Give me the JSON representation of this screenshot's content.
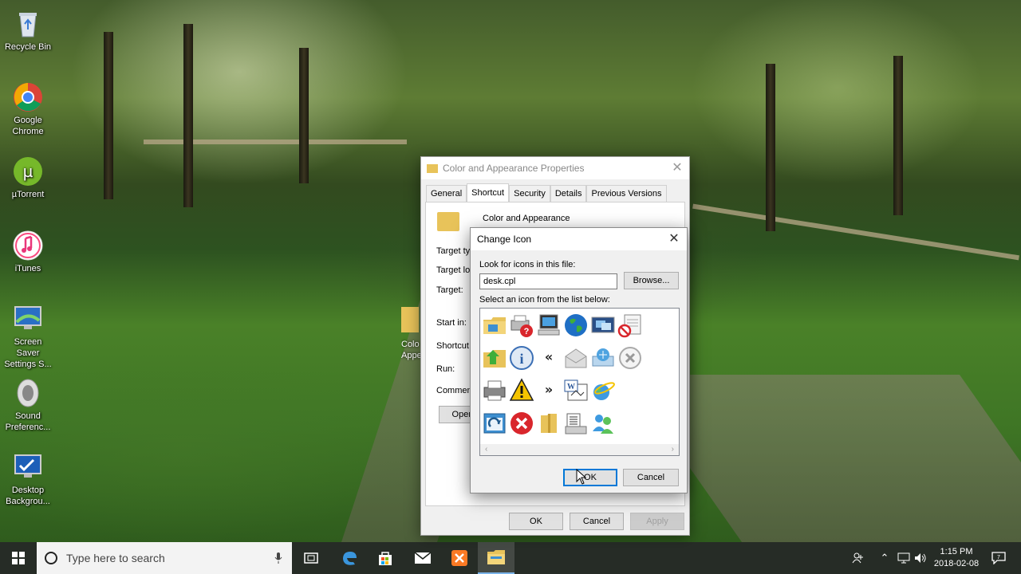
{
  "desktop_icons": [
    {
      "label": "Recycle Bin",
      "icon": "recycle-bin-icon"
    },
    {
      "label": "Google Chrome",
      "icon": "chrome-icon"
    },
    {
      "label": "µTorrent",
      "icon": "utorrent-icon"
    },
    {
      "label": "iTunes",
      "icon": "itunes-icon"
    },
    {
      "label": "Screen Saver Settings S...",
      "icon": "screensaver-icon"
    },
    {
      "label": "Sound Preferenc...",
      "icon": "speaker-icon"
    },
    {
      "label": "Desktop Backgrou...",
      "icon": "desktop-background-icon"
    }
  ],
  "partial_desktop_label": "Colo Appe",
  "properties": {
    "title": "Color and Appearance Properties",
    "tabs": [
      "General",
      "Shortcut",
      "Security",
      "Details",
      "Previous Versions"
    ],
    "active_tab": "Shortcut",
    "shortcut_name": "Color and Appearance",
    "fields": [
      "Target typ",
      "Target loc",
      "Target:",
      "Start in:",
      "Shortcut k",
      "Run:",
      "Comment:"
    ],
    "open_button": "Open",
    "ok": "OK",
    "cancel": "Cancel",
    "apply": "Apply"
  },
  "change_icon": {
    "title": "Change Icon",
    "look_label": "Look for icons in this file:",
    "file_value": "desk.cpl",
    "browse": "Browse...",
    "select_label": "Select an icon from the list below:",
    "icons": [
      "folder-icon",
      "printer-help-icon",
      "computer-icon",
      "globe-icon",
      "display-icon",
      "blocked-document-icon",
      "folder-arrow-icon",
      "info-icon",
      "rewind-icon",
      "envelope-icon",
      "network-share-icon",
      "delete-icon",
      "printer-icon",
      "warning-icon",
      "fast-forward-icon",
      "word-document-icon",
      "internet-icon",
      "refresh-window-icon",
      "error-icon",
      "zip-folder-icon",
      "list-document-icon",
      "users-icon"
    ],
    "ok": "OK",
    "cancel": "Cancel"
  },
  "taskbar": {
    "search_placeholder": "Type here to search",
    "apps": [
      "task-view-icon",
      "edge-icon",
      "store-icon",
      "mail-icon",
      "xampp-icon",
      "file-explorer-icon"
    ],
    "time": "1:15 PM",
    "date": "2018-02-08"
  },
  "colors": {
    "taskbar": "#1a201a",
    "dialog": "#f0f0f0",
    "accent": "#0078d7",
    "warning": "#f5c400",
    "error": "#d9262c"
  }
}
